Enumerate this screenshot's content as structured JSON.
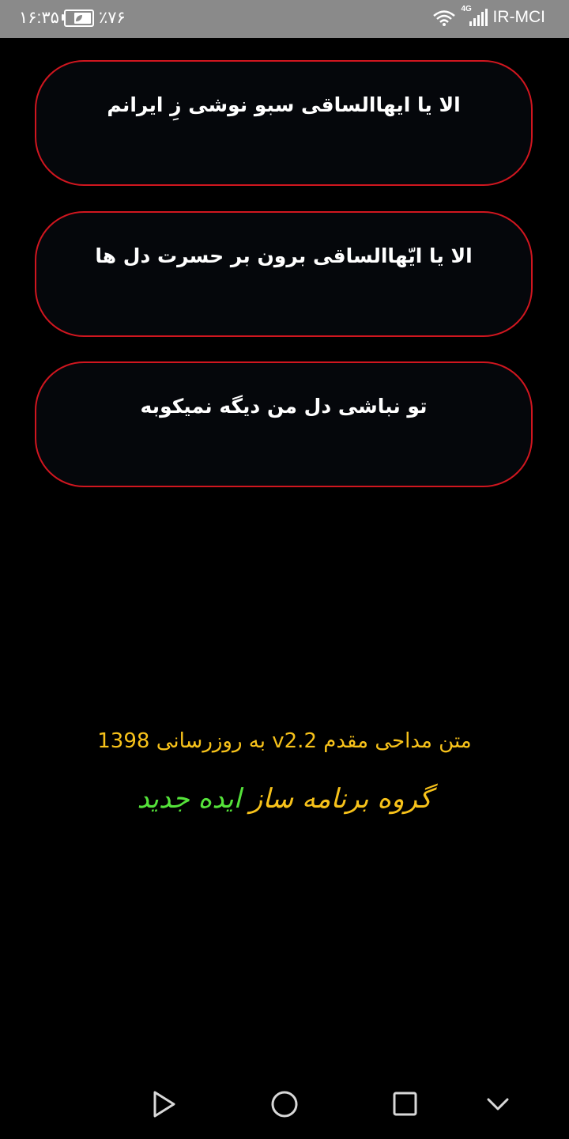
{
  "status_bar": {
    "time": "۱۶:۳۵",
    "battery": "٪۷۶",
    "battery_level": 0.76,
    "network_type": "4G",
    "carrier": "IR-MCI"
  },
  "list": {
    "items": [
      {
        "title": "الا یا ایهاالساقی سبو نوشی زِ ایرانم"
      },
      {
        "title": "الا یا ایّهاالساقی برون بر حسرت دل ها"
      },
      {
        "title": "تو نباشی دل من دیگه نمیکوبه"
      }
    ]
  },
  "footer": {
    "version_text": "متن مداحی مقدم v2.2 به روزرسانی 1398",
    "group_prefix": "گروه برنامه ساز",
    "group_name": "ایده جدید",
    "colors": {
      "version": "#f7c21a",
      "group_prefix": "#f7c21a",
      "group_name": "#55e33a",
      "card_border": "#d0161f"
    }
  },
  "nav_bar": {
    "icons": [
      "play-triangle-icon",
      "circle-home-icon",
      "square-recents-icon",
      "chevron-down-icon"
    ]
  }
}
